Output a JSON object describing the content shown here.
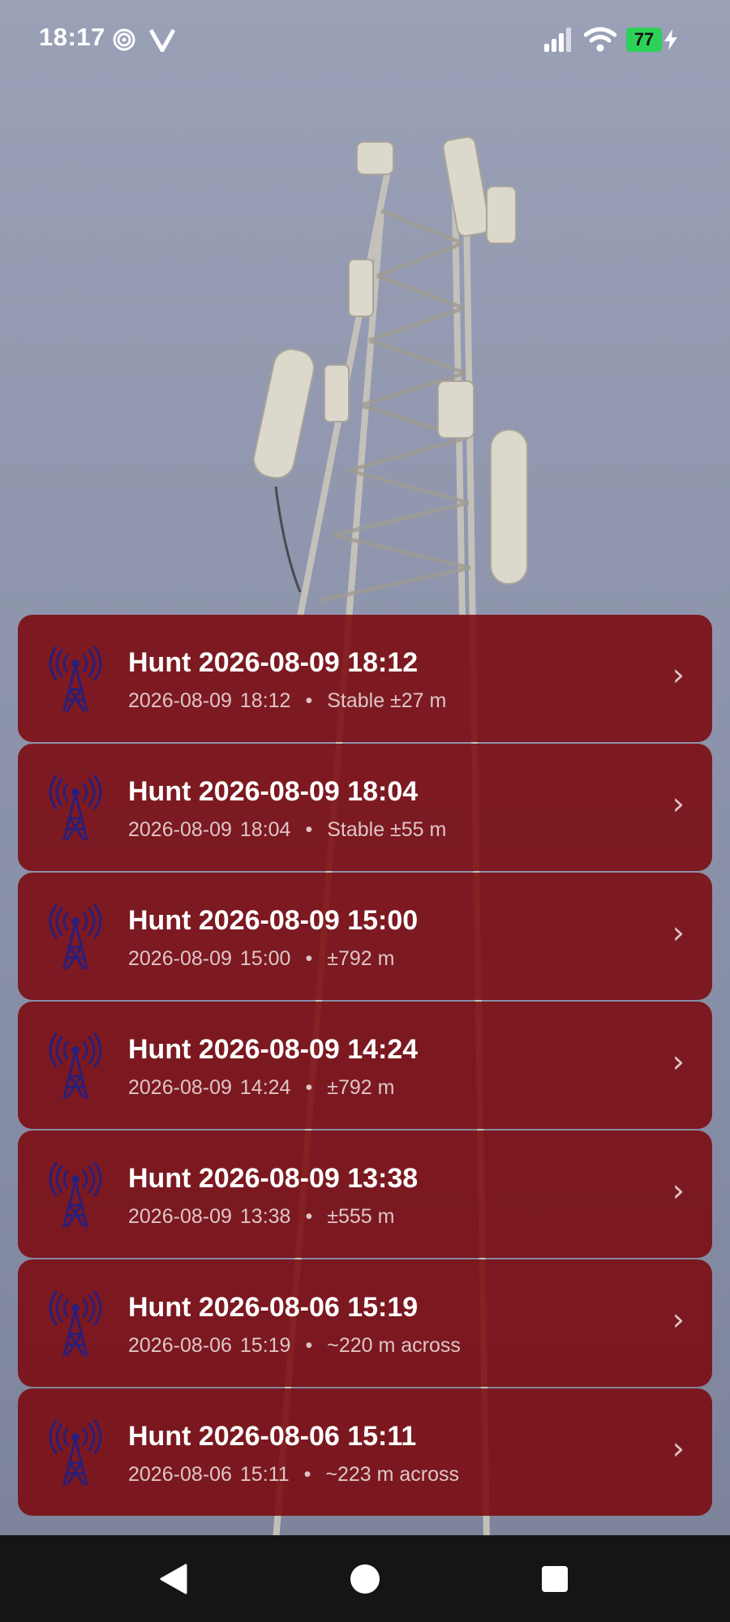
{
  "status_bar": {
    "time": "18:17",
    "battery_level": "77",
    "icons": [
      "spiral-app-icon",
      "v-app-icon",
      "signal-icon",
      "wifi-icon",
      "battery-icon",
      "charging-icon"
    ]
  },
  "colors": {
    "card_background": "#7a060a",
    "title_text": "#ffffff",
    "tower_icon": "#2a1e7a",
    "battery_green": "#2ed158",
    "nav_bar": "#141517"
  },
  "hunts": [
    {
      "title": "Hunt 2026-08-09 18:12",
      "date": "2026-08-09",
      "time": "18:12",
      "dot": "•",
      "detail": "Stable ±27 m",
      "chevron": "›"
    },
    {
      "title": "Hunt 2026-08-09 18:04",
      "date": "2026-08-09",
      "time": "18:04",
      "dot": "•",
      "detail": "Stable ±55 m",
      "chevron": "›"
    },
    {
      "title": "Hunt 2026-08-09 15:00",
      "date": "2026-08-09",
      "time": "15:00",
      "dot": "•",
      "detail": "±792 m",
      "chevron": "›"
    },
    {
      "title": "Hunt 2026-08-09 14:24",
      "date": "2026-08-09",
      "time": "14:24",
      "dot": "•",
      "detail": "±792 m",
      "chevron": "›"
    },
    {
      "title": "Hunt 2026-08-09 13:38",
      "date": "2026-08-09",
      "time": "13:38",
      "dot": "•",
      "detail": "±555 m",
      "chevron": "›"
    },
    {
      "title": "Hunt 2026-08-06 15:19",
      "date": "2026-08-06",
      "time": "15:19",
      "dot": "•",
      "detail": "~220 m across",
      "chevron": "›"
    },
    {
      "title": "Hunt 2026-08-06 15:11",
      "date": "2026-08-06",
      "time": "15:11",
      "dot": "•",
      "detail": "~223 m across",
      "chevron": "›"
    }
  ],
  "nav": {
    "buttons": [
      "back-icon",
      "home-icon",
      "recents-icon"
    ]
  }
}
